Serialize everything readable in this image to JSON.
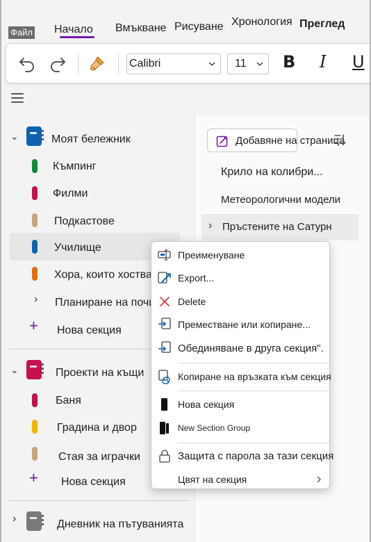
{
  "menu": {
    "file": "Файл",
    "tabs": [
      "Начало",
      "Вмъкване",
      "Рисуване",
      "Хронология",
      "Преглед"
    ]
  },
  "toolbar": {
    "font_name": "Calibri",
    "font_size": "11",
    "bold": "B",
    "italic": "I",
    "underline": "U"
  },
  "notebooks": [
    {
      "name": "Моят бележник",
      "color": "#1062b0",
      "sections": [
        {
          "name": "Къмпинг",
          "color": "#0a8a3a"
        },
        {
          "name": "Филми",
          "color": "#c4114f"
        },
        {
          "name": "Подкастове",
          "color": "#c8a57a"
        },
        {
          "name": "Училище",
          "color": "#1062b0"
        },
        {
          "name": "Хора, които хоствам",
          "color": "#e86a10"
        }
      ],
      "group": "Планиране на почивка",
      "new_section": "Нова секция"
    },
    {
      "name": "Проекти на къщи",
      "color": "#c4114f",
      "sections": [
        {
          "name": "Баня",
          "color": "#c4114f"
        },
        {
          "name": "Градина и двор",
          "color": "#f2b600"
        },
        {
          "name": "Стая за играчки",
          "color": "#c8a57a"
        }
      ],
      "new_section": "Нова секция"
    },
    {
      "name": "Дневник на пътуванията",
      "color": "#7a7a7a"
    }
  ],
  "pages": {
    "add_page": "Добавяне на страница",
    "items": [
      "Крило на колибри...",
      "Метеорологични модели",
      "Пръстените на Сатурн"
    ]
  },
  "context_menu": {
    "items": [
      "Преименуване",
      "Export...",
      "Delete",
      "Преместване или копиране...",
      "Обединяване в друга секция\".",
      "Копиране на връзката към секция",
      "Нова секция",
      "New Section Group",
      "Защита с парола за тази секция",
      "Цвят на секция"
    ]
  },
  "colors": {
    "accent": "#7719aa"
  }
}
